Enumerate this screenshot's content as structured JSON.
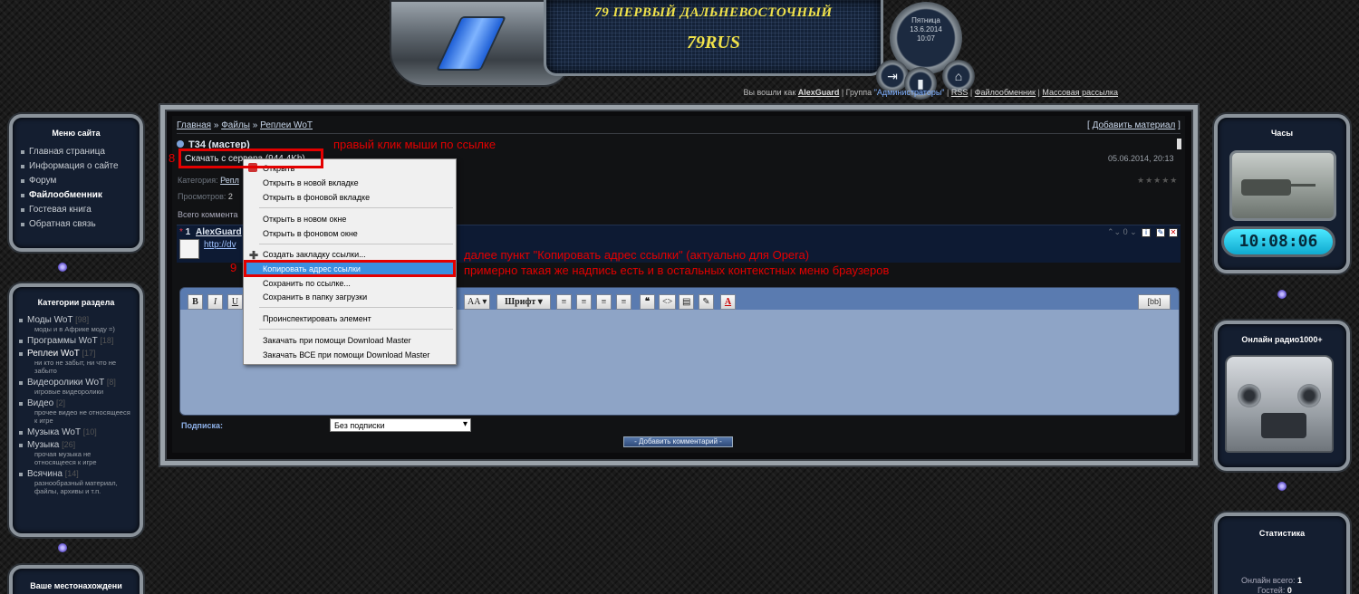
{
  "header": {
    "title": "79 ПЕРВЫЙ ДАЛЬНЕВОСТОЧНЫЙ",
    "logo": "79RUS",
    "date_day": "Пятница",
    "date": "13.6.2014",
    "time": "10:07"
  },
  "userbar": {
    "logged_as": "Вы вошли как",
    "user": "AlexGuard",
    "group_label": "Группа",
    "group": "\"Администраторы\"",
    "rss": "RSS",
    "files": "Файлообменник",
    "mailing": "Массовая рассылка"
  },
  "left_menu": {
    "title": "Меню сайта",
    "items": [
      {
        "label": "Главная страница"
      },
      {
        "label": "Информация о сайте"
      },
      {
        "label": "Форум"
      },
      {
        "label": "Файлообменник",
        "active": true
      },
      {
        "label": "Гостевая книга"
      },
      {
        "label": "Обратная связь"
      }
    ]
  },
  "categories": {
    "title": "Категории раздела",
    "items": [
      {
        "label": "Моды WoT",
        "count": "[98]",
        "desc": "моды и в Африке моду =)"
      },
      {
        "label": "Программы WoT",
        "count": "[18]",
        "desc": ""
      },
      {
        "label": "Реплеи WoT",
        "count": "[17]",
        "desc": "ни кто не забыт, ни что не забыто"
      },
      {
        "label": "Видеоролики WoT",
        "count": "[8]",
        "desc": "игровые видеоролики"
      },
      {
        "label": "Видео",
        "count": "[2]",
        "desc": "прочее видео не относящееся к игре"
      },
      {
        "label": "Музыка WoT",
        "count": "[10]",
        "desc": ""
      },
      {
        "label": "Музыка",
        "count": "[26]",
        "desc": "прочая музыка не относящееся к игре"
      },
      {
        "label": "Всячина",
        "count": "[14]",
        "desc": "разнообразный материал, файлы, архивы и т.п."
      }
    ]
  },
  "location_title": "Ваше местонахождени",
  "right": {
    "clock_title": "Часы",
    "clock": "10:08:06",
    "radio_title": "Онлайн радио1000+",
    "stats_title": "Статистика",
    "online_label": "Онлайн всего:",
    "online_value": "1",
    "guests_label": "Гостей:",
    "guests_value": "0"
  },
  "content": {
    "crumb_home": "Главная",
    "crumb_sep": "»",
    "crumb_files": "Файлы",
    "crumb_replays": "Реплеи WoT",
    "add_material": "Добавить материал",
    "file_title": "T34 (мастер)",
    "download": "Скачать с сервера (944.4Kb)",
    "date": "05.06.2014, 20:13",
    "category_label": "Категория:",
    "category_value": "Репл",
    "views_label": "Просмотров:",
    "views_value": "2",
    "total_comments": "Всего коммента",
    "comment_num": "1",
    "comment_user": "AlexGuard",
    "comment_link": "http://dv",
    "rating": "0",
    "subscription_label": "Подписка:",
    "subscription_value": "Без подписки",
    "add_comment": "- Добавить комментарий -",
    "bb": "[bb]"
  },
  "editor": {
    "buttons": [
      "B",
      "I",
      "U"
    ],
    "size_btn": "AA",
    "font_btn": "Шрифт",
    "quote_btn": "❝",
    "code_btn": "<>",
    "color_btn": "A"
  },
  "context_menu": {
    "items": [
      "Открыть",
      "Открыть в новой вкладке",
      "Открыть в фоновой вкладке",
      "Открыть в новом окне",
      "Открыть в фоновом окне",
      "Создать закладку ссылки...",
      "Копировать адрес ссылки",
      "Сохранить по ссылке...",
      "Сохранить в папку загрузки",
      "Проинспектировать элемент",
      "Закачать при помощи Download Master",
      "Закачать ВСЕ при помощи Download Master"
    ]
  },
  "annotations": {
    "step8": "8",
    "step9": "9",
    "note1": "правый клик мыши по ссылке",
    "note2": "далее пункт \"Копировать адрес ссылки\" (актуально для Opera)",
    "note3": "примерно такая же надпись есть и в остальных контекстных меню браузеров"
  }
}
